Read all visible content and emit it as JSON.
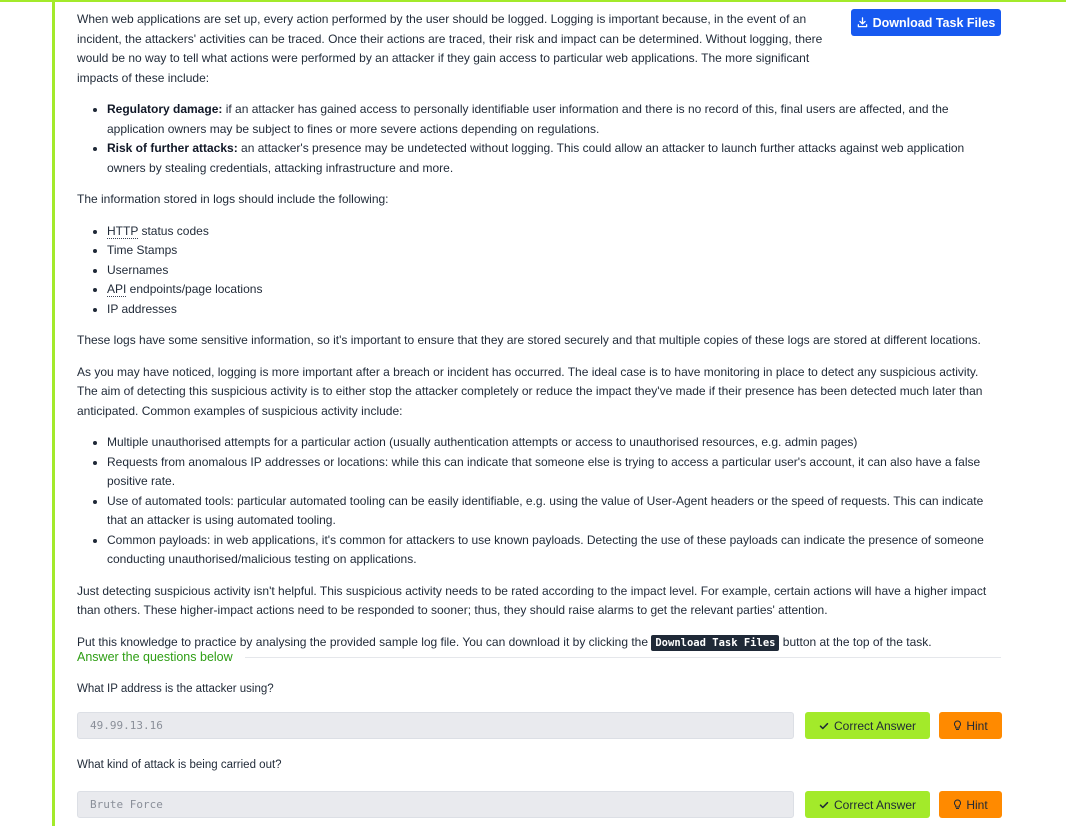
{
  "toolbar": {
    "download_label": "Download Task Files",
    "download_icon": "download-icon"
  },
  "content": {
    "intro": "When web applications are set up, every action performed by the user should be logged. Logging is important because, in the event of an incident, the attackers' activities can be traced. Once their actions are traced, their risk and impact can be determined. Without logging, there would be no way to tell what actions were performed by an attacker if they gain access to particular web applications. The more significant impacts of these include:",
    "impacts": [
      {
        "title": "Regulatory damage:",
        "text": " if an attacker has gained access to personally identifiable user information and there is no record of this, final users are affected, and the application owners may be subject to fines or more severe actions depending on regulations."
      },
      {
        "title": "Risk of further attacks:",
        "text": " an attacker's presence may be undetected without logging. This could allow an attacker to launch further attacks against web application owners by stealing credentials, attacking infrastructure and more."
      }
    ],
    "logs_intro": "The information stored in logs should include the following:",
    "log_fields": {
      "http_abbr": "HTTP",
      "http_rest": " status codes",
      "timestamps": "Time Stamps",
      "usernames": "Usernames",
      "api_abbr": "API",
      "api_rest": " endpoints/page locations",
      "ip": "IP addresses"
    },
    "storage": "These logs have some sensitive information, so it's important to ensure that they are stored securely and that multiple copies of these logs are stored at different locations.",
    "monitoring": "As you may have noticed, logging is more important after a breach or incident has occurred. The ideal case is to have monitoring in place to detect any suspicious activity. The aim of detecting this suspicious activity is to either stop the attacker completely or reduce the impact they've made if their presence has been detected much later than anticipated. Common examples of suspicious activity include:",
    "suspicious": [
      "Multiple unauthorised attempts for a particular action (usually authentication attempts or access to unauthorised resources, e.g. admin pages)",
      "Requests from anomalous IP addresses or locations: while this can indicate that someone else is trying to access a particular user's account, it can also have a false positive rate.",
      "Use of automated tools: particular automated tooling can be easily identifiable, e.g. using the value of User-Agent headers or the speed of requests. This can indicate that an attacker is using automated tooling.",
      "Common payloads: in web applications, it's common for attackers to use known payloads. Detecting the use of these payloads can indicate the presence of someone conducting unauthorised/malicious testing on applications."
    ],
    "rating": "Just detecting suspicious activity isn't helpful. This suspicious activity needs to be rated according to the impact level. For example, certain actions will have a higher impact than others. These higher-impact actions need to be responded to sooner; thus, they should raise alarms to get the relevant parties' attention.",
    "practice_before": "Put this knowledge to practice by analysing the provided sample log file. You can download it by clicking the ",
    "practice_code": "Download Task Files",
    "practice_after": " button at the top of the task."
  },
  "qa": {
    "header": "Answer the questions below",
    "questions": [
      {
        "text": "What IP address is the attacker using?",
        "answer": "49.99.13.16",
        "correct_label": "Correct Answer",
        "hint_label": "Hint"
      },
      {
        "text": "What kind of attack is being carried out?",
        "answer": "Brute Force",
        "correct_label": "Correct Answer",
        "hint_label": "Hint"
      }
    ]
  },
  "colors": {
    "accent": "#a3ea2a",
    "primary_button": "#1759f0",
    "hint_button": "#ff8a00",
    "section_header": "#2e9e14"
  }
}
